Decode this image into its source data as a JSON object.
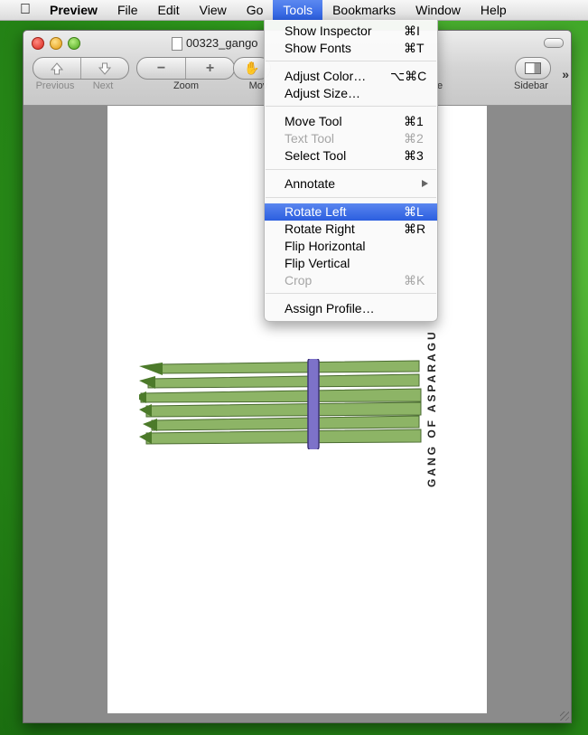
{
  "menubar": {
    "app_name": "Preview",
    "items": [
      "File",
      "Edit",
      "View",
      "Go",
      "Tools",
      "Bookmarks",
      "Window",
      "Help"
    ],
    "active_item": "Tools"
  },
  "window": {
    "title": "00323_gango",
    "toolbar": {
      "previous_label": "Previous",
      "next_label": "Next",
      "zoom_label": "Zoom",
      "move_label": "Mov",
      "sidebar_label": "Sidebar",
      "right_partial_label": "e"
    }
  },
  "document": {
    "caption": "GANG OF ASPARAGU"
  },
  "tools_menu": {
    "items": [
      {
        "label": "Show Inspector",
        "shortcut": "⌘I",
        "enabled": true
      },
      {
        "label": "Show Fonts",
        "shortcut": "⌘T",
        "enabled": true
      },
      {
        "label": "Adjust Color…",
        "shortcut": "⌥⌘C",
        "enabled": true
      },
      {
        "label": "Adjust Size…",
        "shortcut": "",
        "enabled": true
      },
      {
        "label": "Move Tool",
        "shortcut": "⌘1",
        "enabled": true
      },
      {
        "label": "Text Tool",
        "shortcut": "⌘2",
        "enabled": false
      },
      {
        "label": "Select Tool",
        "shortcut": "⌘3",
        "enabled": true
      },
      {
        "label": "Annotate",
        "shortcut": "",
        "enabled": true,
        "submenu": true
      },
      {
        "label": "Rotate Left",
        "shortcut": "⌘L",
        "enabled": true,
        "highlighted": true
      },
      {
        "label": "Rotate Right",
        "shortcut": "⌘R",
        "enabled": true
      },
      {
        "label": "Flip Horizontal",
        "shortcut": "",
        "enabled": true
      },
      {
        "label": "Flip Vertical",
        "shortcut": "",
        "enabled": true
      },
      {
        "label": "Crop",
        "shortcut": "⌘K",
        "enabled": false
      },
      {
        "label": "Assign Profile…",
        "shortcut": "",
        "enabled": true
      }
    ]
  },
  "colors": {
    "highlight": "#2c5fe0",
    "desktop": "#2f9a1c",
    "band": "#7d72c9",
    "asparagus": "#7fa85a"
  }
}
